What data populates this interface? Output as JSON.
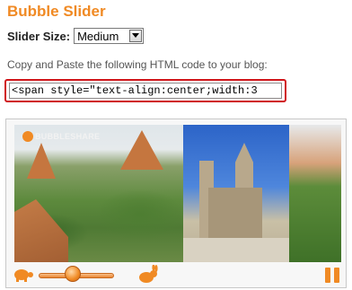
{
  "title": "Bubble Slider",
  "slider_size": {
    "label": "Slider Size:",
    "selected": "Medium"
  },
  "instructions": "Copy and Paste the following HTML code to your blog:",
  "code_field": {
    "value": "<span style=\"text-align:center;width:3"
  },
  "preview": {
    "logo_text": "BUBBLESHARE",
    "speed_level": 0.45
  },
  "colors": {
    "accent": "#f08a24",
    "highlight_border": "#d0161b"
  },
  "icons": {
    "slow": "turtle-icon",
    "fast": "rabbit-icon",
    "pause": "pause-icon",
    "dropdown": "chevron-down-icon"
  }
}
